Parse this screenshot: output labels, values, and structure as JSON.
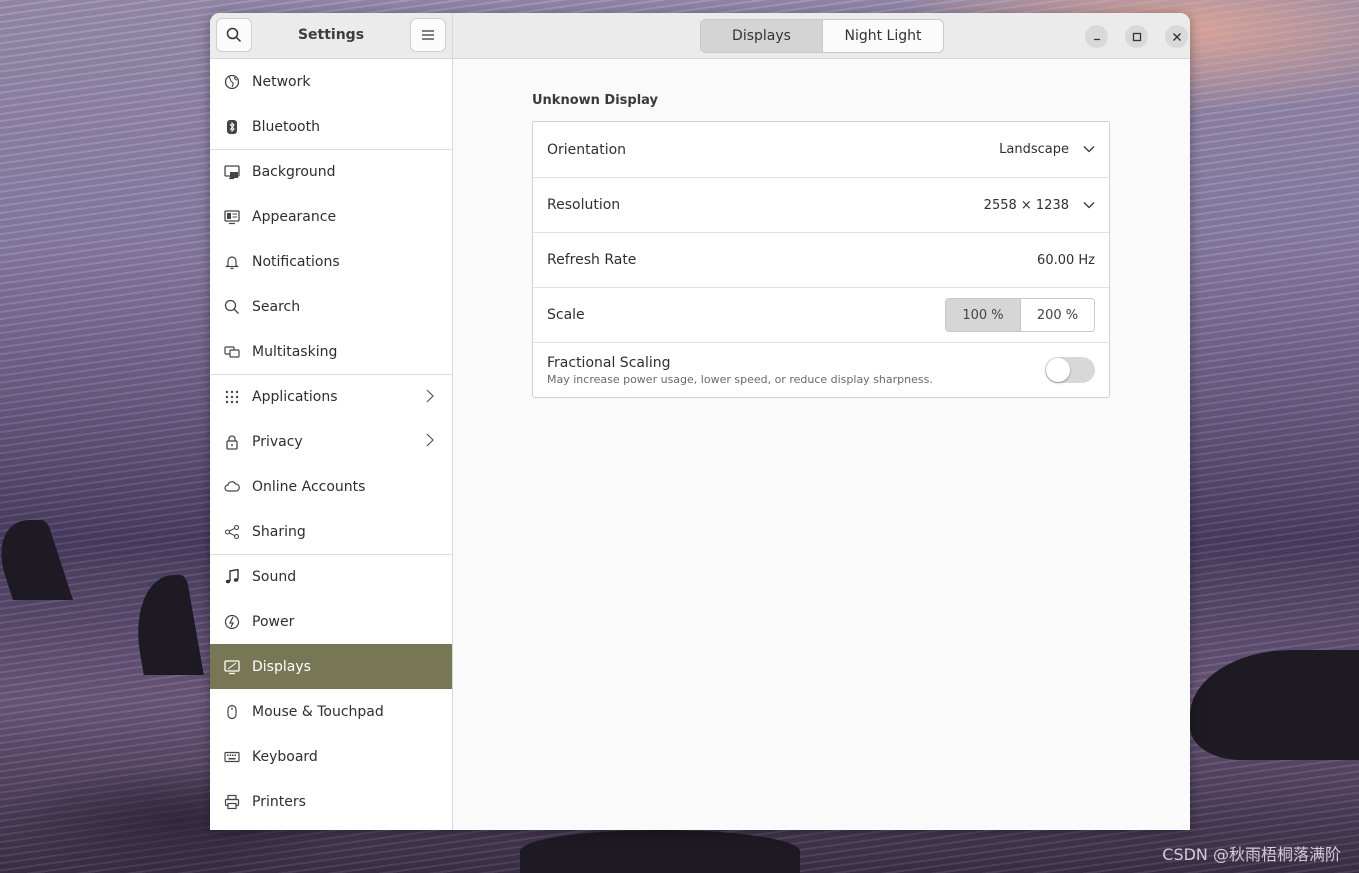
{
  "sidebar": {
    "title": "Settings",
    "items": [
      {
        "label": "Network",
        "icon": "globe-icon"
      },
      {
        "label": "Bluetooth",
        "icon": "bluetooth-icon"
      },
      {
        "label": "Background",
        "icon": "monitor-image-icon"
      },
      {
        "label": "Appearance",
        "icon": "appearance-icon"
      },
      {
        "label": "Notifications",
        "icon": "bell-icon"
      },
      {
        "label": "Search",
        "icon": "search-icon"
      },
      {
        "label": "Multitasking",
        "icon": "windows-icon"
      },
      {
        "label": "Applications",
        "icon": "grid-icon"
      },
      {
        "label": "Privacy",
        "icon": "lock-icon"
      },
      {
        "label": "Online Accounts",
        "icon": "cloud-icon"
      },
      {
        "label": "Sharing",
        "icon": "share-icon"
      },
      {
        "label": "Sound",
        "icon": "music-note-icon"
      },
      {
        "label": "Power",
        "icon": "power-icon"
      },
      {
        "label": "Displays",
        "icon": "display-icon"
      },
      {
        "label": "Mouse & Touchpad",
        "icon": "mouse-icon"
      },
      {
        "label": "Keyboard",
        "icon": "keyboard-icon"
      },
      {
        "label": "Printers",
        "icon": "printer-icon"
      }
    ],
    "active_item": "Displays"
  },
  "header": {
    "tabs": [
      "Displays",
      "Night Light"
    ],
    "active_tab": "Displays"
  },
  "display": {
    "name": "Unknown Display",
    "orientation": {
      "label": "Orientation",
      "value": "Landscape"
    },
    "resolution": {
      "label": "Resolution",
      "value": "2558 × 1238"
    },
    "refresh_rate": {
      "label": "Refresh Rate",
      "value": "60.00 Hz"
    },
    "scale": {
      "label": "Scale",
      "options": [
        "100 %",
        "200 %"
      ],
      "selected": "100 %"
    },
    "fractional_scaling": {
      "label": "Fractional Scaling",
      "description": "May increase power usage, lower speed, or reduce display sharpness.",
      "enabled": false
    }
  },
  "desktop": {
    "watermark": "CSDN @秋雨梧桐落满阶"
  },
  "colors": {
    "active_sidebar": "#777755",
    "window_bg": "#fafafa"
  }
}
